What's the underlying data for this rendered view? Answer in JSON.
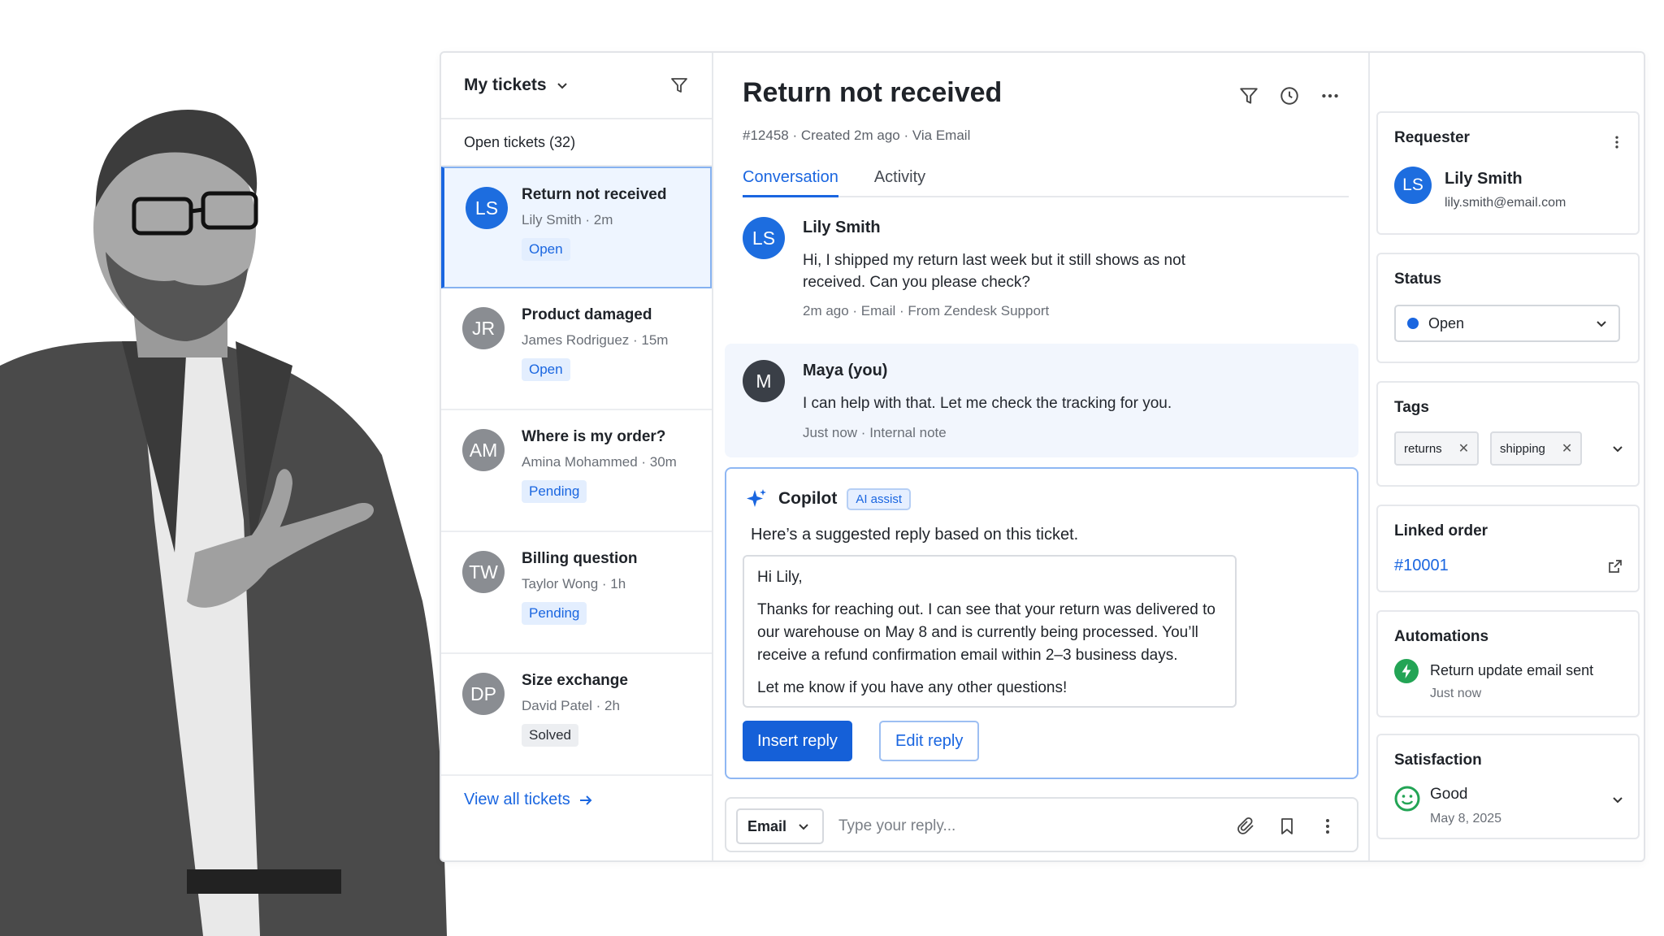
{
  "left": {
    "header": "My tickets",
    "open_count": "Open tickets (32)",
    "tickets": [
      {
        "initials": "LS",
        "title": "Return not received",
        "meta": "Lily Smith  ·  2m",
        "status": "Open"
      },
      {
        "initials": "JR",
        "title": "Product damaged",
        "meta": "James Rodriguez  ·  15m",
        "status": "Open"
      },
      {
        "initials": "AM",
        "title": "Where is my order?",
        "meta": "Amina Mohammed  ·  30m",
        "status": "Pending"
      },
      {
        "initials": "TW",
        "title": "Billing question",
        "meta": "Taylor Wong  ·  1h",
        "status": "Pending"
      },
      {
        "initials": "DP",
        "title": "Size exchange",
        "meta": "David Patel  ·  2h",
        "status": "Solved"
      }
    ],
    "view_all": "View all tickets"
  },
  "ticket": {
    "subject": "Return not received",
    "meta": "#12458   ·   Created 2m ago   ·   Via Email",
    "tabs": [
      "Conversation",
      "Activity"
    ]
  },
  "messages": [
    {
      "initials": "LS",
      "name": "Lily Smith",
      "body": "Hi, I shipped my return last week but it still shows as not received. Can you please check?",
      "foot": "2m ago   ·   Email   ·   From Zendesk Support"
    },
    {
      "initials": "M",
      "name": "Maya (you)",
      "body": "I can help with that. Let me check the tracking for you.",
      "foot": "Just now   ·   Internal note"
    }
  ],
  "copilot": {
    "name": "Copilot",
    "badge": "AI assist",
    "intro": "Here’s a suggested reply based on this ticket.",
    "greeting": "Hi Lily,",
    "paragraph": "Thanks for reaching out. I can see that your return was delivered to our warehouse on May 8 and is currently being processed. You’ll receive a refund confirmation email within 2–3 business days.",
    "closing": "Let me know if you have any other questions!",
    "insert_label": "Insert reply",
    "edit_label": "Edit reply"
  },
  "composer": {
    "channel": "Email",
    "placeholder": "Type your reply..."
  },
  "right": {
    "requester_title": "Requester",
    "requester_initials": "LS",
    "requester_name": "Lily Smith",
    "requester_email": "lily.smith@email.com",
    "status_title": "Status",
    "status_value": "Open",
    "tags_title": "Tags",
    "tags": [
      "returns",
      "shipping"
    ],
    "linked_title": "Linked order",
    "linked_value": "#10001",
    "automations_title": "Automations",
    "automation_text": "Return update email sent",
    "automation_time": "Just now",
    "satisfaction_title": "Satisfaction",
    "satisfaction_value": "Good",
    "satisfaction_date": "May 8, 2025"
  },
  "colors": {
    "accent": "#1a66e0",
    "success": "#23a455",
    "border": "#e6e8ec"
  }
}
